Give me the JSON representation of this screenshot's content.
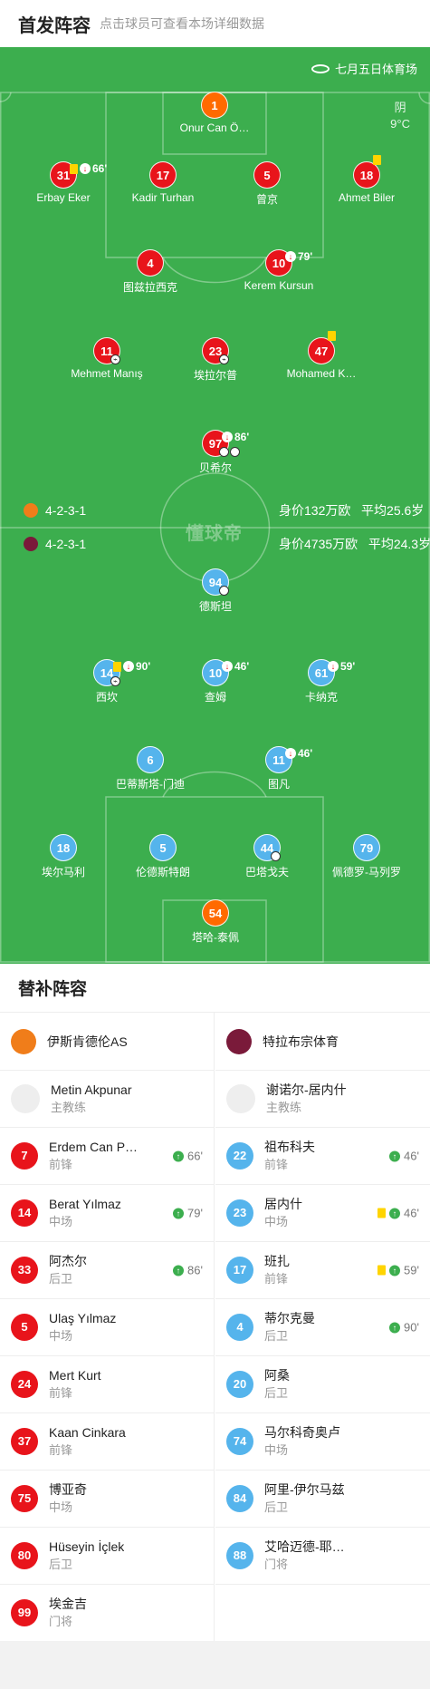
{
  "header": {
    "title": "首发阵容",
    "subtitle": "点击球员可查看本场详细数据"
  },
  "venue": "七月五日体育场",
  "weather": {
    "condition": "阴",
    "temp": "9°C"
  },
  "center_logo": "懂球帝",
  "team_home": {
    "formation": "4-2-3-1",
    "value": "身价132万欧",
    "age": "平均25.6岁"
  },
  "team_away": {
    "formation": "4-2-3-1",
    "value": "身价4735万欧",
    "age": "平均24.3岁"
  },
  "home_players": [
    {
      "num": "1",
      "name": "Onur Can Ö…",
      "gk": true
    },
    {
      "num": "31",
      "name": "Erbay Eker",
      "yellow": true,
      "sub": "66'"
    },
    {
      "num": "17",
      "name": "Kadir Turhan"
    },
    {
      "num": "5",
      "name": "曾京"
    },
    {
      "num": "18",
      "name": "Ahmet Biler",
      "yellow": true
    },
    {
      "num": "4",
      "name": "图兹拉西克"
    },
    {
      "num": "10",
      "name": "Kerem Kursun",
      "sub": "79'"
    },
    {
      "num": "11",
      "name": "Mehmet Manış",
      "boot": true
    },
    {
      "num": "23",
      "name": "埃拉尔普",
      "boot": true
    },
    {
      "num": "47",
      "name": "Mohamed K…",
      "yellow": true
    },
    {
      "num": "97",
      "name": "贝希尔",
      "sub": "86'",
      "goals": 2
    }
  ],
  "away_players": [
    {
      "num": "94",
      "name": "德斯坦",
      "goals": 1
    },
    {
      "num": "14",
      "name": "西坎",
      "yellow": true,
      "sub": "90'",
      "boot": true
    },
    {
      "num": "10",
      "name": "查姆",
      "sub": "46'"
    },
    {
      "num": "61",
      "name": "卡纳克",
      "sub": "59'"
    },
    {
      "num": "6",
      "name": "巴蒂斯塔-门迪"
    },
    {
      "num": "11",
      "name": "图凡",
      "sub": "46'"
    },
    {
      "num": "18",
      "name": "埃尔马利"
    },
    {
      "num": "5",
      "name": "伦德斯特朗"
    },
    {
      "num": "44",
      "name": "巴塔戈夫",
      "goals": 1
    },
    {
      "num": "79",
      "name": "佩德罗-马列罗"
    },
    {
      "num": "54",
      "name": "塔哈-泰佩",
      "gk": true
    }
  ],
  "subs_title": "替补阵容",
  "subs_home": {
    "team": "伊斯肯德伦AS",
    "coach": {
      "name": "Metin Akpunar",
      "role": "主教练"
    },
    "players": [
      {
        "num": "7",
        "name": "Erdem Can P…",
        "pos": "前锋",
        "in": "66'"
      },
      {
        "num": "14",
        "name": "Berat Yılmaz",
        "pos": "中场",
        "in": "79'"
      },
      {
        "num": "33",
        "name": "阿杰尔",
        "pos": "后卫",
        "in": "86'"
      },
      {
        "num": "5",
        "name": "Ulaş Yılmaz",
        "pos": "中场"
      },
      {
        "num": "24",
        "name": "Mert Kurt",
        "pos": "前锋"
      },
      {
        "num": "37",
        "name": "Kaan Cinkara",
        "pos": "前锋"
      },
      {
        "num": "75",
        "name": "博亚奇",
        "pos": "中场"
      },
      {
        "num": "80",
        "name": "Hüseyin İçlek",
        "pos": "后卫"
      },
      {
        "num": "99",
        "name": "埃金吉",
        "pos": "门将"
      }
    ]
  },
  "subs_away": {
    "team": "特拉布宗体育",
    "coach": {
      "name": "谢诺尔-居内什",
      "role": "主教练"
    },
    "players": [
      {
        "num": "22",
        "name": "祖布科夫",
        "pos": "前锋",
        "in": "46'"
      },
      {
        "num": "23",
        "name": "居内什",
        "pos": "中场",
        "in": "46'",
        "yellow": true
      },
      {
        "num": "17",
        "name": "班扎",
        "pos": "前锋",
        "in": "59'",
        "yellow": true
      },
      {
        "num": "4",
        "name": "蒂尔克曼",
        "pos": "后卫",
        "in": "90'"
      },
      {
        "num": "20",
        "name": "阿桑",
        "pos": "后卫"
      },
      {
        "num": "74",
        "name": "马尔科奇奥卢",
        "pos": "中场"
      },
      {
        "num": "84",
        "name": "阿里-伊尔马兹",
        "pos": "后卫"
      },
      {
        "num": "88",
        "name": "艾哈迈德-耶…",
        "pos": "门将"
      }
    ]
  },
  "colors": {
    "pitch": "#3cae4e",
    "home": "#e8141b",
    "away": "#55b4ec",
    "gk": "#ff6a00"
  }
}
